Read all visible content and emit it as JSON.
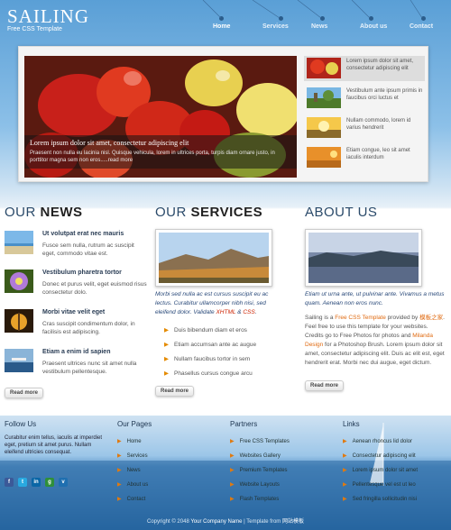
{
  "header": {
    "title": "SAILING",
    "subtitle": "Free CSS Template",
    "nav": [
      "Home",
      "Services",
      "News",
      "About us",
      "Contact"
    ]
  },
  "slider": {
    "caption_title": "Lorem ipsum dolor sit amet, consectetur adipiscing elit",
    "caption_text": "Praesent non nulla eu lacinia nisl. Quisque vehicula, lorem in ultrices porta, turpis diam ornare justo, in porttitor magna sem non eros.....read more",
    "thumbs": [
      "Lorem ipsum dolor sit amet, consectetur adipiscing elit",
      "Vestibulum ante ipsum primis in faucibus orci luctus et",
      "Nullam commodo, lorem id varius hendrerit",
      "Etiam congue, leo sit amet iaculis interdum"
    ]
  },
  "news": {
    "heading_a": "OUR ",
    "heading_b": "NEWS",
    "items": [
      {
        "title": "Ut volutpat erat nec mauris",
        "body": "Fusce sem nulla, rutrum ac suscipit eget, commodo vitae est."
      },
      {
        "title": "Vestibulum pharetra tortor",
        "body": "Donec et purus velit, eget euismod risus consectetur dolo."
      },
      {
        "title": "Morbi vitae velit eget",
        "body": "Cras suscipit condimentum dolor, in facilisis est adipiscing."
      },
      {
        "title": "Etiam a enim id sapien",
        "body": "Praesent ultrices nunc sit amet nulla vestibulum pellentesque."
      }
    ],
    "more": "Read more"
  },
  "services": {
    "heading_a": "OUR ",
    "heading_b": "SERVICES",
    "intro_1": "Morbi sed nulla ac est cursus suscipit eu ac lectus. Curabitur ullamcorper nibh nisi, sed eleifend dolor. Validate",
    "xhtml": "XHTML",
    "amp": " & ",
    "css": "CSS",
    "period": ".",
    "items": [
      "Duis bibendum diam et eros",
      "Etiam accumsan ante ac augue",
      "Nullam faucibus tortor in sem",
      "Phasellus cursus congue arcu"
    ],
    "more": "Read more"
  },
  "about": {
    "heading": "ABOUT US",
    "intro": "Etiam ut urna ante, ut pulvinar ante. Vivamus a metus quam. Aenean non eros nunc.",
    "p1": "Sailing is a",
    "free_link": "Free CSS Template",
    "p2": "provided by",
    "brand": "模板之家",
    "p3": ". Feel free to use this template for your websites. Credits go to Free Photos for photos and",
    "milanda": "Milanda Design",
    "p4": "for a Photoshop Brush. Lorem ipsum dolor sit amet, consectetur adipiscing elit. Duis ac elit est, eget hendrerit erat. Morbi nec dui augue, eget dictum.",
    "more": "Read more"
  },
  "footer": {
    "follow_title": "Follow Us",
    "follow_text": "Curabitur enim tellus, iaculis at imperdiet eget, pretium sit amet purus. Nullam eleifend ultricies consequat.",
    "pages_title": "Our Pages",
    "pages": [
      "Home",
      "Services",
      "News",
      "About us",
      "Contact"
    ],
    "partners_title": "Partners",
    "partners": [
      "Free CSS Templates",
      "Websites Gallery",
      "Premium Templates",
      "Website Layouts",
      "Flash Templates"
    ],
    "links_title": "Links",
    "links": [
      "Aenean rhoncus lid dolor",
      "Consectetur adipiscing elit",
      "Lorem ipsum dolor sit amet",
      "Pellentesque vel est ut leo",
      "Sed fringilla sollicitudin nisi"
    ],
    "social": [
      "f",
      "t",
      "in",
      "g",
      "v"
    ]
  },
  "copyright": {
    "text_a": "Copyright © 2048",
    "company": "Your Company Name",
    "text_b": "| Template from",
    "source": "网站模板"
  },
  "colors": {
    "accent": "#e06a10",
    "sky": "#5a9fd6",
    "heading": "#2a4a6a"
  }
}
